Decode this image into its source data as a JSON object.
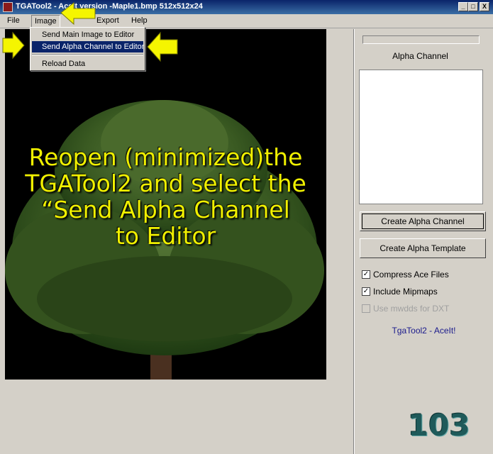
{
  "window": {
    "title": "TGATool2 - AceIt version -Maple1.bmp  512x512x24",
    "minimize": "_",
    "maximize": "□",
    "close": "X"
  },
  "menubar": {
    "items": [
      "File",
      "Image",
      "Export",
      "Help"
    ]
  },
  "dropdown": {
    "items": [
      "Send Main Image to Editor",
      "Send Alpha Channel to Editor",
      "Reload Data"
    ],
    "highlighted": "Send Alpha Channel to Editor"
  },
  "image_overlay": {
    "line1": "Reopen (minimized)the",
    "line2": "TGATool2 and select the",
    "line3": "“Send Alpha Channel",
    "line4": "to Editor"
  },
  "sidebar": {
    "alpha_label": "Alpha Channel",
    "create_alpha_channel": "Create Alpha Channel",
    "create_alpha_template": "Create Alpha Template",
    "compress_ace": {
      "label": "Compress Ace Files",
      "checked": true
    },
    "include_mipmaps": {
      "label": "Include Mipmaps",
      "checked": true
    },
    "use_mwdds": {
      "label": "Use mwdds for DXT",
      "checked": false,
      "enabled": false
    },
    "brand": "TgaTool2 - AceIt!"
  },
  "slide_number": "103",
  "colors": {
    "arrow": "#f5f500",
    "overlay_text": "#f0f000",
    "highlight": "#0a246a"
  }
}
